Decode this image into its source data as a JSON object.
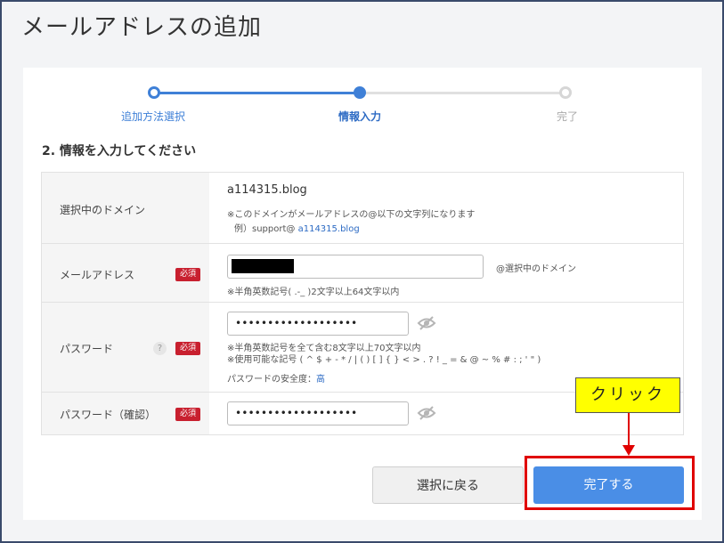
{
  "page": {
    "title": "メールアドレスの追加"
  },
  "stepper": {
    "steps": [
      {
        "label": "追加方法選択",
        "state": "done"
      },
      {
        "label": "情報入力",
        "state": "current"
      },
      {
        "label": "完了",
        "state": "pending"
      }
    ]
  },
  "section": {
    "title": "2. 情報を入力してください"
  },
  "form": {
    "domain": {
      "label": "選択中のドメイン",
      "value": "a114315.blog",
      "note": "※このドメインがメールアドレスの@以下の文字列になります",
      "example_prefix": "例）support@",
      "example_domain": "a114315.blog"
    },
    "email": {
      "label": "メールアドレス",
      "required": "必須",
      "suffix": "@選択中のドメイン",
      "note": "※半角英数記号( .-_ )2文字以上64文字以内"
    },
    "password": {
      "label": "パスワード",
      "help": "?",
      "required": "必須",
      "value": "•••••••••••••••••••",
      "note1": "※半角英数記号を全て含む8文字以上70文字以内",
      "note2": "※使用可能な記号 ( ^ $ + - * / | ( ) [ ] { } < > . ? ! _ = & @ ~ % # : ; ' \" )",
      "strength_label": "パスワードの安全度：",
      "strength_value": "高"
    },
    "password_confirm": {
      "label": "パスワード（確認）",
      "required": "必須",
      "value": "•••••••••••••••••••"
    }
  },
  "buttons": {
    "back": "選択に戻る",
    "done": "完了する"
  },
  "annotation": {
    "callout": "クリック"
  },
  "colors": {
    "accent": "#3f80d7",
    "required": "#c8202f",
    "highlight": "#e00000",
    "callout_bg": "#ffff00"
  }
}
